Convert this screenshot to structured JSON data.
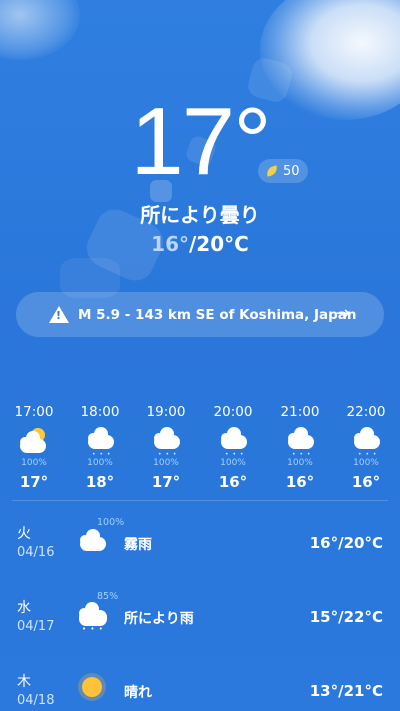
{
  "current": {
    "temperature": "17°",
    "aqi": "50",
    "condition": "所により曇り",
    "range_low": "16°",
    "range_high": "/20°C"
  },
  "alert": {
    "text": "M 5.9 - 143 km SE of Koshima, Japan",
    "arrow": "→"
  },
  "hourly": [
    {
      "time": "17:00",
      "icon": "partly-cloudy-icon",
      "prob": "100%",
      "temp": "17°"
    },
    {
      "time": "18:00",
      "icon": "cloud-drizzle-icon",
      "prob": "100%",
      "temp": "18°"
    },
    {
      "time": "19:00",
      "icon": "cloud-drizzle-icon",
      "prob": "100%",
      "temp": "17°"
    },
    {
      "time": "20:00",
      "icon": "cloud-drizzle-icon",
      "prob": "100%",
      "temp": "16°"
    },
    {
      "time": "21:00",
      "icon": "cloud-drizzle-icon",
      "prob": "100%",
      "temp": "16°"
    },
    {
      "time": "22:00",
      "icon": "cloud-drizzle-icon",
      "prob": "100%",
      "temp": "16°"
    }
  ],
  "daily": [
    {
      "day": "火",
      "date": "04/16",
      "prob": "100%",
      "condition": "霧雨",
      "range": "16°/20°C",
      "icon": "cloud-drizzle-icon"
    },
    {
      "day": "水",
      "date": "04/17",
      "prob": "85%",
      "condition": "所により雨",
      "range": "15°/22°C",
      "icon": "cloud-rain-icon"
    },
    {
      "day": "木",
      "date": "04/18",
      "prob": "",
      "condition": "晴れ",
      "range": "13°/21°C",
      "icon": "sun-icon"
    }
  ]
}
